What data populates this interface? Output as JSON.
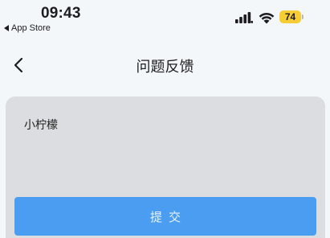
{
  "status_bar": {
    "time": "09:43",
    "back_app_label": "App Store",
    "battery_level": "74",
    "icons": [
      "signal-icon",
      "wifi-icon",
      "battery-icon"
    ]
  },
  "nav": {
    "title": "问题反馈",
    "back_icon": "chevron-left-icon"
  },
  "feedback": {
    "value": "小柠檬"
  },
  "submit": {
    "label": "提交"
  },
  "colors": {
    "background": "#f4f7fa",
    "input_bg": "#dcdde1",
    "submit_bg": "#4a9df0",
    "battery": "#f7cd33"
  }
}
